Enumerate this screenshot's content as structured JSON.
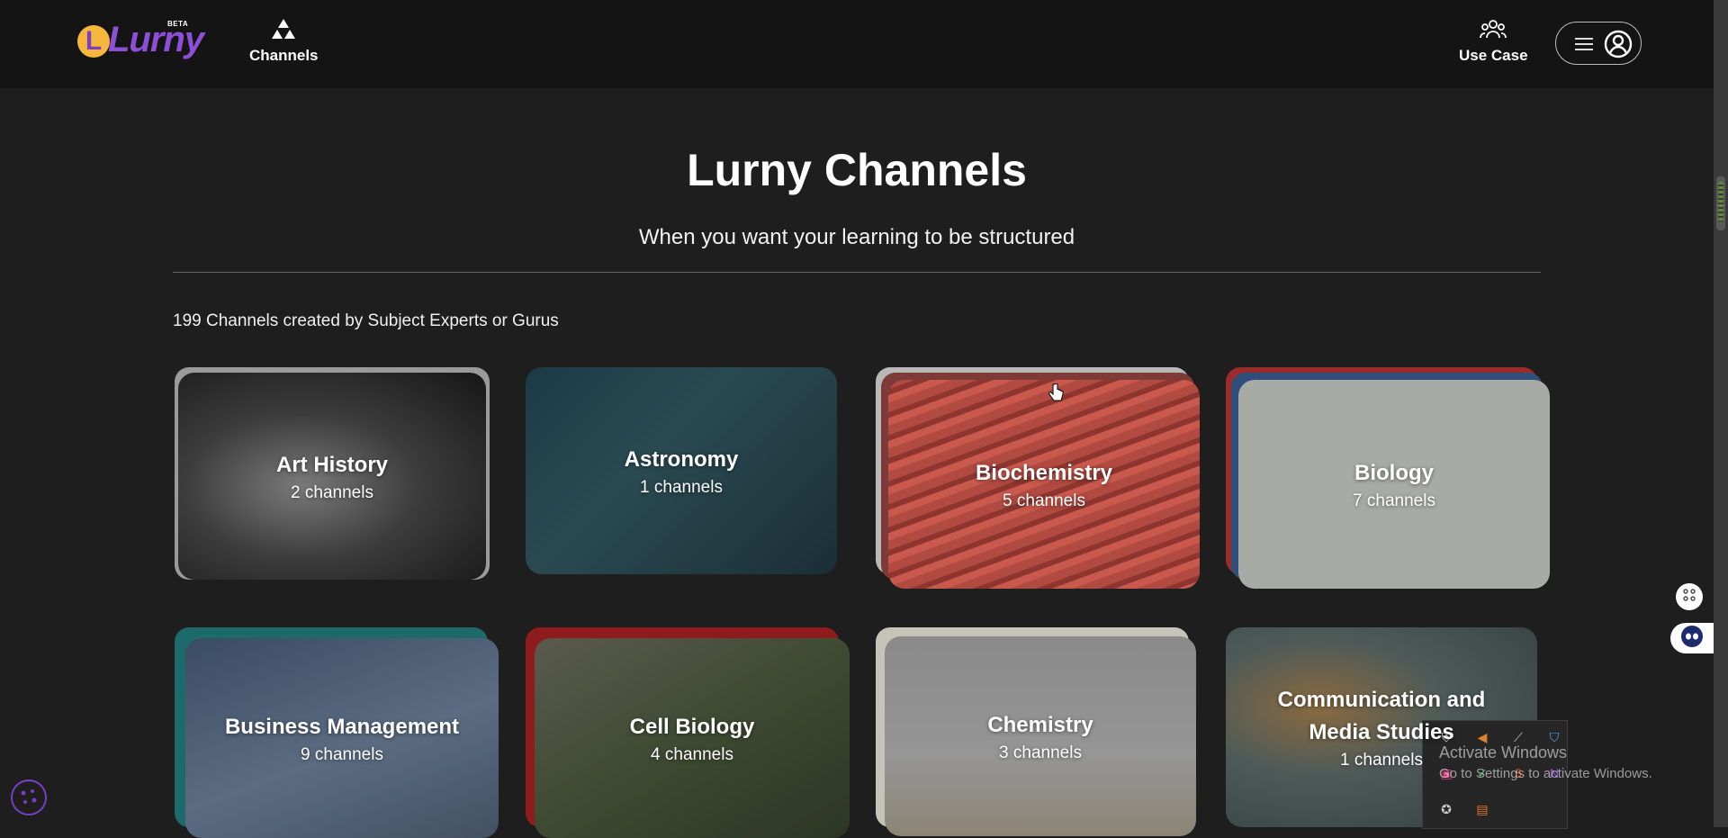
{
  "header": {
    "logo_text": "Lurny",
    "logo_letter": "L",
    "logo_badge": "BETA",
    "nav_channels": "Channels",
    "nav_use_case": "Use Case"
  },
  "main": {
    "title": "Lurny Channels",
    "subtitle": "When you want your learning to be structured",
    "count_text": "199 Channels created by Subject Experts or Gurus"
  },
  "cards": [
    {
      "title": "Art History",
      "sub": "2 channels",
      "color": "#3a3a3a"
    },
    {
      "title": "Astronomy",
      "sub": "1 channels",
      "color": "#1d3a44"
    },
    {
      "title": "Biochemistry",
      "sub": "5 channels",
      "color": "#a8443c"
    },
    {
      "title": "Biology",
      "sub": "7 channels",
      "color": "#a9aca6"
    },
    {
      "title": "Business Management",
      "sub": "9 channels",
      "color": "#485a70"
    },
    {
      "title": "Cell Biology",
      "sub": "4 channels",
      "color": "#4a4a3a"
    },
    {
      "title": "Chemistry",
      "sub": "3 channels",
      "color": "#8f8f8f"
    },
    {
      "title": "Communication and Media Studies",
      "sub": "1 channels",
      "color": "#5e6a6a"
    }
  ],
  "system": {
    "activate_title": "Activate Windows",
    "activate_sub": "Go to Settings to activate Windows."
  },
  "colors": {
    "background": "#1e1e1e",
    "header": "#141414",
    "brand_purple": "#8c4fd6",
    "brand_yellow": "#f6b73c"
  },
  "icons": [
    "channels-icon",
    "use-case-icon",
    "hamburger-icon",
    "user-circle-icon",
    "cookie-icon",
    "shortcut-icon",
    "assistant-icon"
  ]
}
